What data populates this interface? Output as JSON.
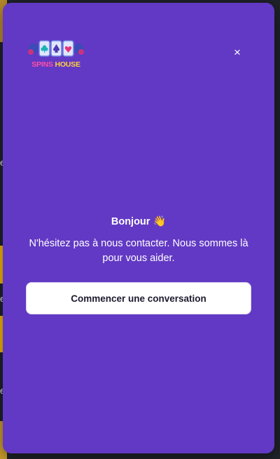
{
  "brand": {
    "logo_word_1": "SPINS",
    "logo_word_2": "HOUSE"
  },
  "widget": {
    "close_icon": "×",
    "greeting": "Bonjour",
    "wave_emoji": "👋",
    "message": "N'hésitez pas à nous contacter. Nous sommes là pour vous aider.",
    "start_button": "Commencer une conversation"
  },
  "colors": {
    "panel": "#6239c4",
    "button_bg": "#ffffff",
    "logo_pink": "#ff4fa7",
    "logo_yellow": "#ffd23a"
  },
  "icons": [
    "close-icon",
    "wave-icon"
  ]
}
